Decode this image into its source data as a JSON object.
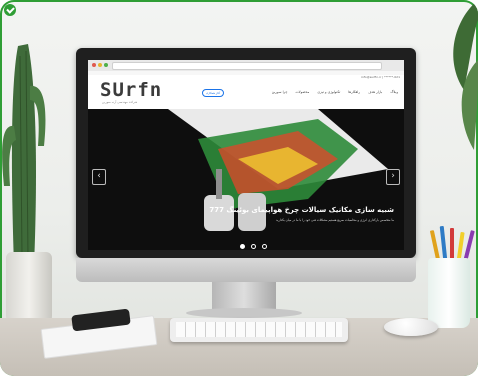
{
  "browser": {
    "url": ""
  },
  "site": {
    "logo": "SUrfn",
    "logo_sub": "شرکت مهندسی آرنه سورین",
    "contact": "021-******  |  info@surfin.ir",
    "nav": [
      "چرا سورین",
      "محصولات",
      "تکنولوژی و تیزی",
      "راهکارها",
      "بازار هدف",
      "وبلاگ"
    ],
    "cta": "آغاز همکاری"
  },
  "slider": {
    "title": "شبیه سازی مکانیک سیالات چرخ هواپیمای بوئینگ 777",
    "text": "ما متخصص بارگذاری انرژی و محاسبات سریع هستیم\nمشکلات فنی خود را با ما در میان بگذارید",
    "prev_icon": "chevron-left-icon",
    "next_icon": "chevron-right-icon",
    "active_index": 0,
    "count": 3
  },
  "colors": {
    "accent": "#2f9e35",
    "link": "#1a73e8"
  }
}
